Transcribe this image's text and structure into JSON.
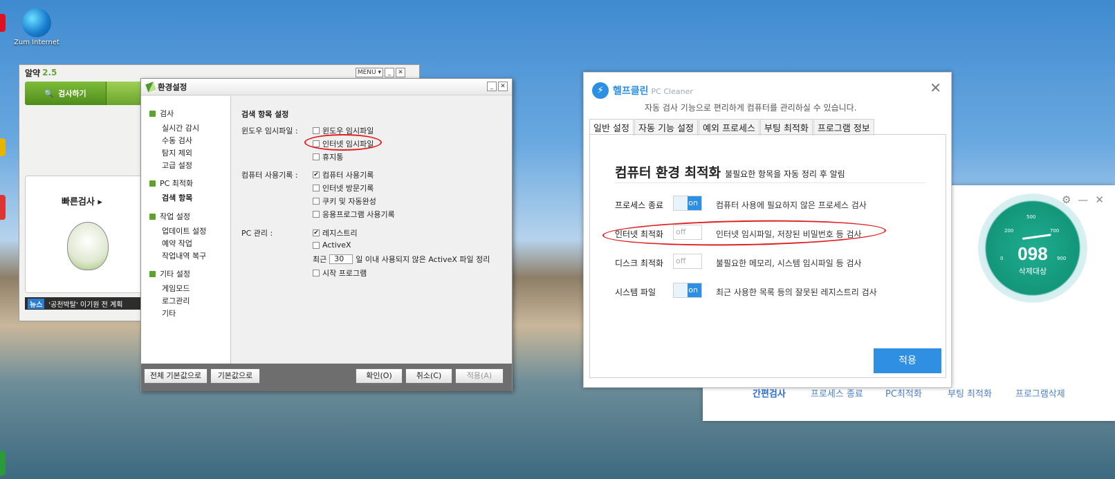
{
  "desktop": {
    "icon_label": "Zum Internet"
  },
  "alyac": {
    "title": "알약",
    "version": "2.5",
    "menu_label": "MENU ▾",
    "minimize": "_",
    "close": "✕",
    "scan_tab": "검사하기",
    "quick_scan": "빠른검사",
    "quick_scan_arrow": "▸",
    "news_tag": "뉴스",
    "news_text": "'공천박탈' 이기원 전 계획"
  },
  "settings": {
    "title": "환경설정",
    "minimize": "_",
    "close": "✕",
    "sidebar": {
      "group_scan": "검사",
      "realtime": "실시간 감시",
      "manual": "수동 검사",
      "exclude": "탐지 제외",
      "advanced": "고급 설정",
      "group_pc": "PC 최적화",
      "search_items": "검색 항목",
      "group_task": "작업 설정",
      "update": "업데이트 설정",
      "schedule": "예약 작업",
      "restore": "작업내역 복구",
      "group_etc": "기타 설정",
      "game_mode": "게임모드",
      "log": "로그관리",
      "etc": "기타"
    },
    "section_title": "검색 항목 설정",
    "windows_temp_label": "윈도우 임시파일 :",
    "opt_windows_temp": "윈도우 임시파일",
    "opt_internet_temp": "인터넷 임시파일",
    "opt_recycle": "휴지통",
    "usage_label": "컴퓨터 사용기록 :",
    "opt_pc_usage": "컴퓨터 사용기록",
    "opt_internet_history": "인터넷 방문기록",
    "opt_cookies": "쿠키 및 자동완성",
    "opt_app_usage": "응용프로그램 사용기록",
    "pc_manage_label": "PC 관리 :",
    "opt_registry": "레지스트리",
    "opt_activex": "ActiveX",
    "activex_prefix": "최근",
    "activex_days": "30",
    "activex_suffix": "일 이내 사용되지 않은 ActiveX 파일 정리",
    "opt_startup": "시작 프로그램",
    "check_mark": "✔",
    "btn_all_default": "전체 기본값으로",
    "btn_default": "기본값으로",
    "btn_ok": "확인(O)",
    "btn_cancel": "취소(C)",
    "btn_apply": "적용(A)"
  },
  "helpclean": {
    "brand": "헬프클린",
    "brand_sub": "PC Cleaner",
    "logo_glyph": "⚡",
    "close": "✕",
    "subtitle": "자동 검사 기능으로 편리하게 컴퓨터를 관리하실 수 있습니다.",
    "tabs": [
      "일반 설정",
      "자동 기능 설정",
      "예외 프로세스",
      "부팅 최적화",
      "프로그램 정보"
    ],
    "heading": "컴퓨터 환경 최적화",
    "heading_note": "불필요한 항목을 자동 정리 후 알림",
    "rows": [
      {
        "label": "프로세스 종료",
        "state": "on",
        "desc": "컴퓨터 사용에 필요하지 않은 프로세스 검사"
      },
      {
        "label": "인터넷 최적화",
        "state": "off",
        "desc": "인터넷 임시파일, 저장된 비밀번호 등 검사"
      },
      {
        "label": "디스크 최적화",
        "state": "off",
        "desc": "불필요한 메모리, 시스템 임시파일 등 검사"
      },
      {
        "label": "시스템 파일",
        "state": "on",
        "desc": "최근 사용한 목록 등의 잘못된 레지스트리 검사"
      }
    ],
    "apply": "적용"
  },
  "helpclean_main": {
    "gauge_value": "098",
    "gauge_label": "삭제대상",
    "ticks": [
      "200",
      "500",
      "700",
      "900",
      "0"
    ],
    "gear": "⚙",
    "minimize": "—",
    "close": "✕",
    "nav": [
      "간편검사",
      "프로세스 종료",
      "PC최적화",
      "부팅 최적화",
      "프로그램삭제"
    ]
  },
  "colors": {
    "alyac_green": "#5ba32c",
    "helpclean_blue": "#2e8fe3",
    "annotation_red": "#e01e1e",
    "gauge_green": "#13977c"
  }
}
